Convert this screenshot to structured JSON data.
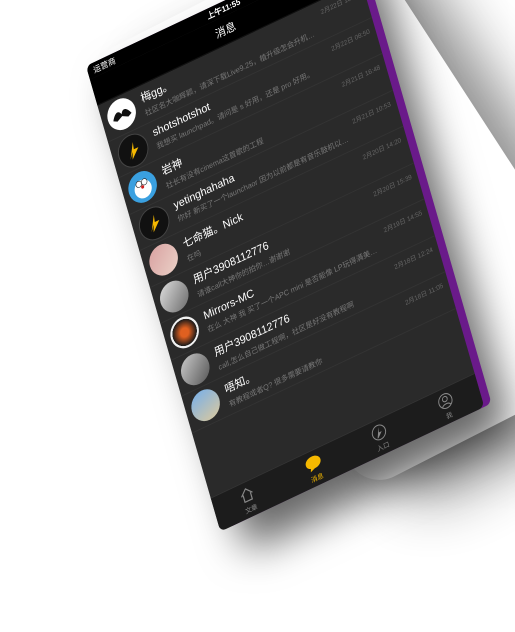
{
  "status": {
    "carrier": "运营商",
    "time": "上午11:55"
  },
  "header": {
    "title": "消息"
  },
  "conversations": [
    {
      "name": "梅gg。",
      "preview": "社区名大咖辉颖，请深下载Live9.25，植升级怎会升机…",
      "time": "2月22日 10:24",
      "avatar": "hands"
    },
    {
      "name": "shotshotshot",
      "preview": "我想买 launchpad。请问是 s 好用，还是 pro 好用。",
      "time": "2月22日 08:50",
      "avatar": "bolt"
    },
    {
      "name": "岩神",
      "preview": "社长有没有cinema这首歌的工程",
      "time": "2月21日 16:48",
      "avatar": "doraemon"
    },
    {
      "name": "yetinghahaha",
      "preview": "你好 新买了一个launchaor 因为以前都是有音乐鼓机以…",
      "time": "2月21日 10:53",
      "avatar": "bolt"
    },
    {
      "name": "七命猫。Nick",
      "preview": "在吗",
      "time": "2月20日 14:20",
      "avatar": "photo1"
    },
    {
      "name": "用户3908112776",
      "preview": "请谁call大神你的拍你…谢谢谢",
      "time": "2月20日 15:39",
      "avatar": "photo2"
    },
    {
      "name": "Mirrors-MC",
      "preview": "在么 大神 我 买了一个APC mini 是否能像 LP玩得满美…",
      "time": "2月19日 14:55",
      "avatar": "butterfly"
    },
    {
      "name": "用户3908112776",
      "preview": "call,怎么自己做工程啊，社区是好没有教程啊",
      "time": "2月18日 12:24",
      "avatar": "photo3"
    },
    {
      "name": "唔知。",
      "preview": "有教程或者Q? 很多需要请教你",
      "time": "2月18日 11:05",
      "avatar": "photo4"
    }
  ],
  "tabs": [
    {
      "label": "文章",
      "icon": "home-icon",
      "active": false
    },
    {
      "label": "消息",
      "icon": "chat-bubble-icon",
      "active": true
    },
    {
      "label": "入口",
      "icon": "bolt-icon",
      "active": false
    },
    {
      "label": "我",
      "icon": "user-icon",
      "active": false
    }
  ],
  "colors": {
    "accent": "#f5b800",
    "background": "#2a2a2a",
    "purple_edge": "#6a1a8a"
  }
}
